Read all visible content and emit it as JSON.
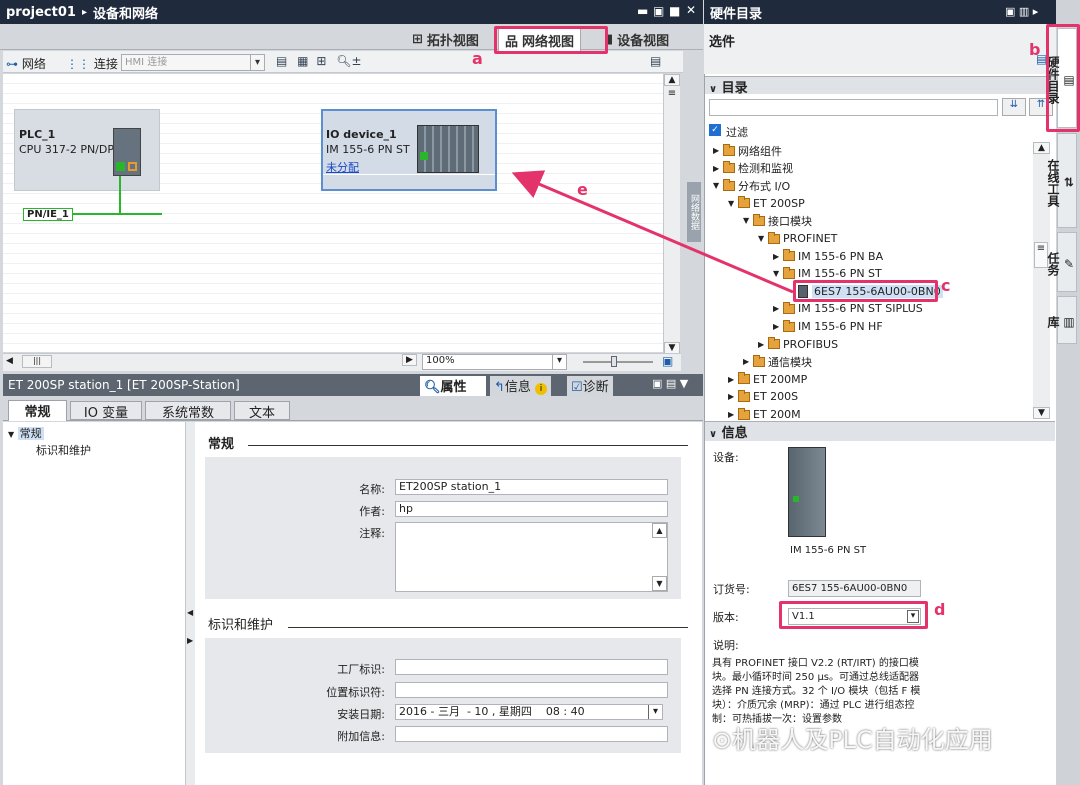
{
  "app": {
    "project": "project01",
    "breadcrumb_sep": "▸",
    "window_title": "设备和网络"
  },
  "view_tabs": [
    "拓扑视图",
    "网络视图",
    "设备视图"
  ],
  "toolbar": {
    "network_label": "网络",
    "connect_label": "连接",
    "hmi_select": "HMI 连接",
    "zoom": "100%"
  },
  "devices": {
    "plc": {
      "name": "PLC_1",
      "type": "CPU 317-2 PN/DP"
    },
    "io": {
      "name": "IO device_1",
      "type": "IM 155-6 PN ST",
      "assign": "未分配"
    },
    "net": "PN/IE_1"
  },
  "vertical_side_label": "网络数据",
  "inspector": {
    "title": "ET 200SP station_1 [ET 200SP-Station]",
    "tabs_right": [
      "属性",
      "信息",
      "诊断"
    ],
    "tabs": [
      "常规",
      "IO 变量",
      "系统常数",
      "文本"
    ],
    "nav": [
      "常规",
      "标识和维护"
    ],
    "section1": "常规",
    "section2": "标识和维护",
    "fields": {
      "name_label": "名称:",
      "name_value": "ET200SP station_1",
      "author_label": "作者:",
      "author_value": "hp",
      "comment_label": "注释:",
      "plant_label": "工厂标识:",
      "location_label": "位置标识符:",
      "date_label": "安装日期:",
      "date_value": "2016 - 三月  - 10 , 星期四    08 : 40",
      "extra_label": "附加信息:"
    }
  },
  "hw_catalog": {
    "title": "硬件目录",
    "options_label": "选件",
    "catalog_label": "目录",
    "filter_label": "过滤",
    "tree": [
      {
        "label": "网络组件",
        "level": 0,
        "exp": "closed"
      },
      {
        "label": "检测和监视",
        "level": 0,
        "exp": "closed"
      },
      {
        "label": "分布式 I/O",
        "level": 0,
        "exp": "open"
      },
      {
        "label": "ET 200SP",
        "level": 1,
        "exp": "open"
      },
      {
        "label": "接口模块",
        "level": 2,
        "exp": "open"
      },
      {
        "label": "PROFINET",
        "level": 3,
        "exp": "open"
      },
      {
        "label": "IM 155-6 PN BA",
        "level": 4,
        "exp": "closed"
      },
      {
        "label": "IM 155-6 PN ST",
        "level": 4,
        "exp": "open"
      },
      {
        "label": "6ES7 155-6AU00-0BN0",
        "level": 5,
        "exp": "none"
      },
      {
        "label": "IM 155-6 PN ST SIPLUS",
        "level": 4,
        "exp": "closed"
      },
      {
        "label": "IM 155-6 PN HF",
        "level": 4,
        "exp": "closed"
      },
      {
        "label": "PROFIBUS",
        "level": 3,
        "exp": "closed"
      },
      {
        "label": "通信模块",
        "level": 2,
        "exp": "closed"
      },
      {
        "label": "ET 200MP",
        "level": 1,
        "exp": "closed"
      },
      {
        "label": "ET 200S",
        "level": 1,
        "exp": "closed"
      },
      {
        "label": "ET 200M",
        "level": 1,
        "exp": "closed"
      }
    ],
    "info_label": "信息",
    "device_label": "设备:",
    "device_name": "IM 155-6 PN ST",
    "order_label": "订货号:",
    "order_value": "6ES7 155-6AU00-0BN0",
    "version_label": "版本:",
    "version_value": "V1.1",
    "desc_label": "说明:",
    "desc_text": "具有 PROFINET 接口 V2.2 (RT/IRT) 的接口模块。最小循环时间 250 µs。可通过总线适配器选择 PN 连接方式。32 个 I/O 模块（包括 F 模块）：介质冗余 (MRP)：通过 PLC 进行组态控制：可热插拔一次：设置参数"
  },
  "side_tabs": [
    "硬件目录",
    "在线工具",
    "任务",
    "库"
  ],
  "annotations": [
    "a",
    "b",
    "c",
    "d",
    "e"
  ],
  "watermark": "机器人及PLC自动化应用",
  "colors": {
    "accent": "#e4336b",
    "title_bg": "#1f2b3d",
    "selection": "#cfe0f5"
  }
}
